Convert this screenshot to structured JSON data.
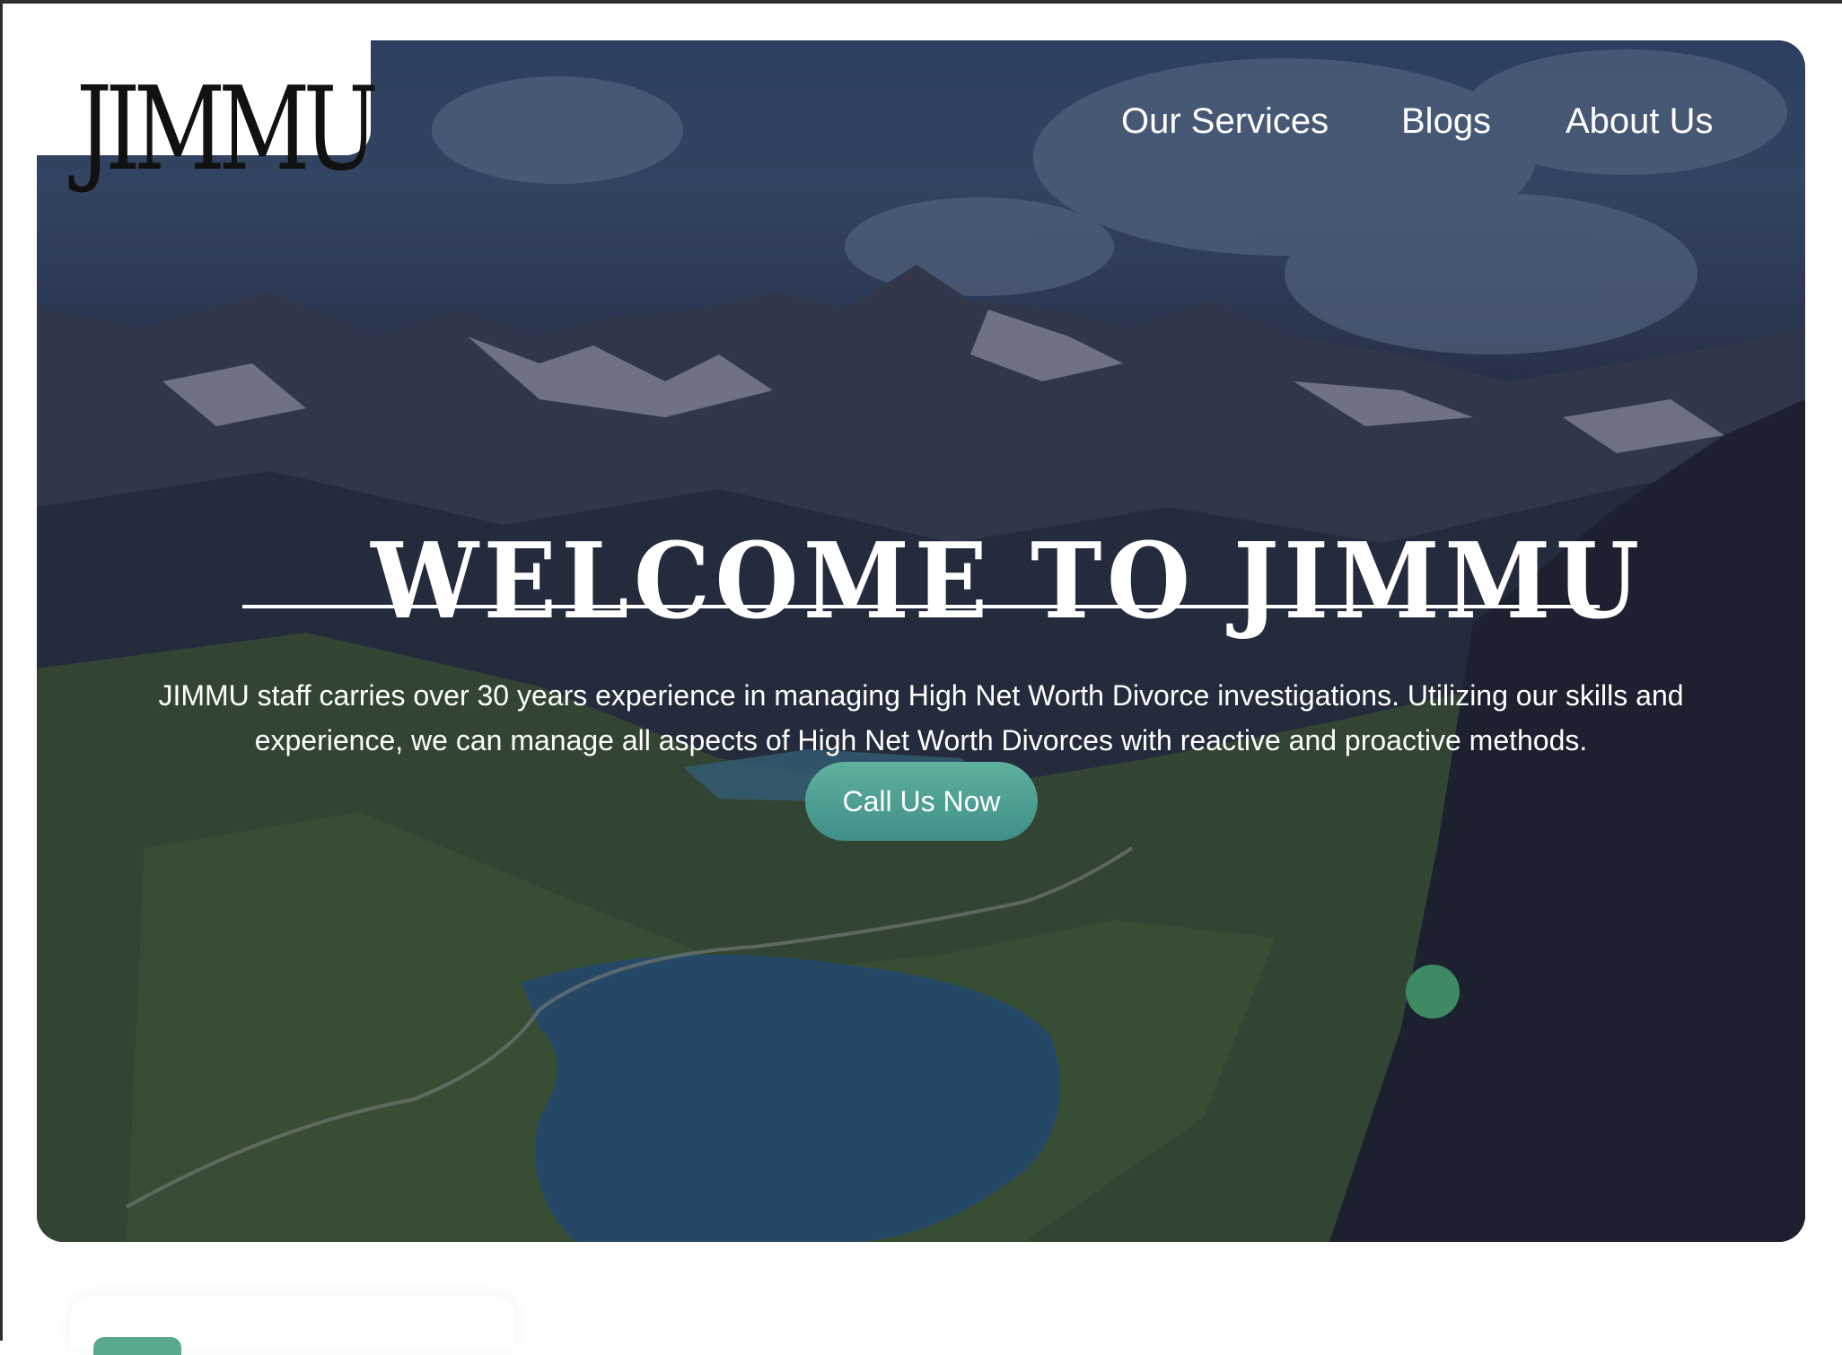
{
  "brand": {
    "logo_text": "JIMMU"
  },
  "nav": {
    "items": [
      {
        "label": "Our Services"
      },
      {
        "label": "Blogs"
      },
      {
        "label": "About Us"
      }
    ]
  },
  "hero": {
    "title": "WELCOME TO JIMMU",
    "description": "JIMMU staff carries over 30 years experience in managing High Net Worth Divorce investigations. Utilizing our skills and experience, we can manage all aspects of High Net Worth Divorces with reactive and proactive methods.",
    "cta_label": "Call Us Now"
  },
  "colors": {
    "accent": "#4f9e92",
    "dot": "#3e8a62",
    "overlay": "#1e2438"
  }
}
